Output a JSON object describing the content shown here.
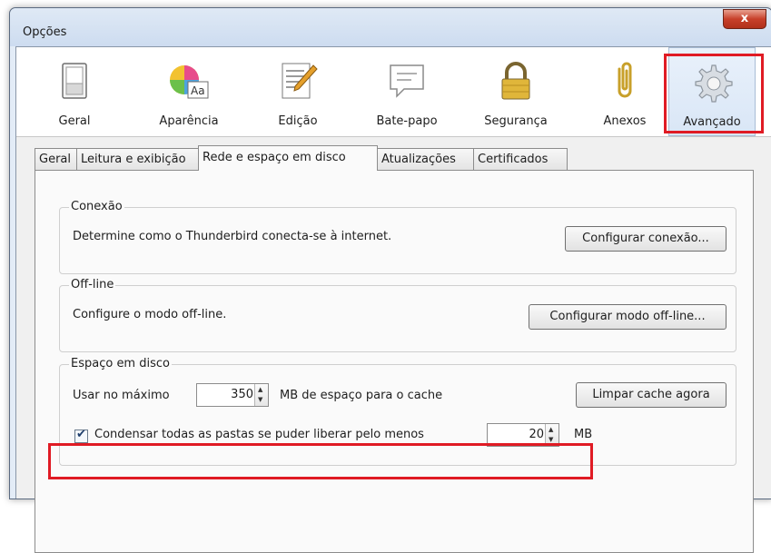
{
  "window": {
    "title": "Opções",
    "close_label": "x"
  },
  "panes": [
    {
      "label": "Geral",
      "icon": "switch-icon"
    },
    {
      "label": "Aparência",
      "icon": "color-wheel-icon"
    },
    {
      "label": "Edição",
      "icon": "document-pencil-icon"
    },
    {
      "label": "Bate-papo",
      "icon": "chat-bubble-icon"
    },
    {
      "label": "Segurança",
      "icon": "padlock-icon"
    },
    {
      "label": "Anexos",
      "icon": "paperclip-icon"
    },
    {
      "label": "Avançado",
      "icon": "gear-icon",
      "selected": true
    }
  ],
  "tabs": [
    {
      "label": "Geral"
    },
    {
      "label": "Leitura e exibição"
    },
    {
      "label": "Rede e espaço em disco",
      "active": true
    },
    {
      "label": "Atualizações"
    },
    {
      "label": "Certificados"
    }
  ],
  "connection": {
    "legend": "Conexão",
    "description": "Determine como o Thunderbird conecta-se à internet.",
    "button_label": "Configurar conexão..."
  },
  "offline": {
    "legend": "Off-line",
    "description": "Configure o modo off-line.",
    "button_label": "Configurar modo off-line..."
  },
  "disk": {
    "legend": "Espaço em disco",
    "max_label": "Usar no máximo",
    "cache_size": "350",
    "cache_suffix": "MB de espaço para o cache",
    "clear_button": "Limpar cache agora",
    "compact_label": "Condensar todas as pastas se puder liberar pelo menos",
    "compact_checked": true,
    "compact_size": "20",
    "compact_unit": "MB"
  },
  "colors": {
    "highlight": "#e01b24",
    "window_frame": "#cddcf0"
  }
}
